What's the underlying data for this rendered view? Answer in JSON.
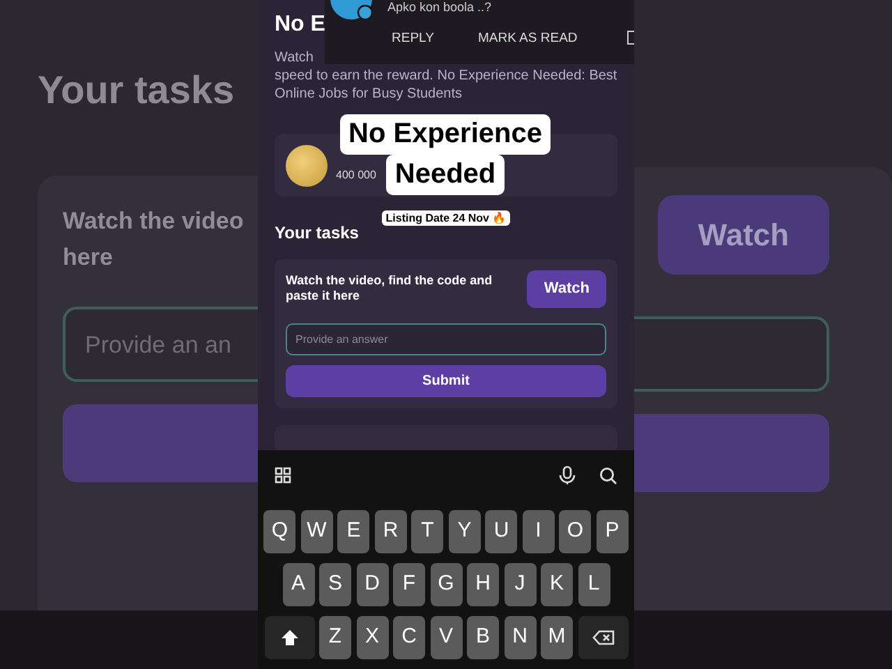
{
  "backdrop": {
    "left": {
      "heading": "Your tasks",
      "task_lines": [
        "Watch the video",
        "here"
      ],
      "placeholder": "Provide an an"
    },
    "right": {
      "button": "Watch"
    }
  },
  "notification": {
    "message": "Apko kon boola ..?",
    "actions": [
      "REPLY",
      "MARK AS READ"
    ]
  },
  "page": {
    "title": "No E",
    "description": [
      "Watch",
      "speed to earn the reward. No Experience Needed: Best Online Jobs for Busy Students"
    ],
    "reward": {
      "amount": "400 000"
    },
    "section": "Your tasks",
    "tasks": [
      {
        "text": "Watch the video, find the code and paste it here",
        "button": "Watch",
        "placeholder": "Provide an answer",
        "submit": "Submit"
      }
    ]
  },
  "caption": {
    "title_lines": [
      "No Experience",
      "Needed"
    ],
    "subtitle": "Listing Date 24 Nov 🔥"
  },
  "keyboard": {
    "rows": [
      [
        "Q",
        "W",
        "E",
        "R",
        "T",
        "Y",
        "U",
        "I",
        "O",
        "P"
      ],
      [
        "A",
        "S",
        "D",
        "F",
        "G",
        "H",
        "J",
        "K",
        "L"
      ],
      [
        "Z",
        "X",
        "C",
        "V",
        "B",
        "N",
        "M"
      ]
    ]
  }
}
